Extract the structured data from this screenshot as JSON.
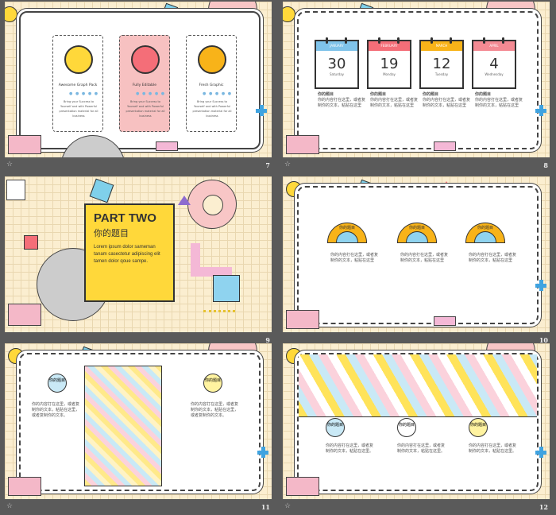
{
  "slides": [
    {
      "number": "7",
      "packages": [
        {
          "title": "Awesome Graph Pack",
          "dots": "● ● ● ● ●",
          "desc": "Bring your Success to Yourself and with Powerful presentation material for all business"
        },
        {
          "title": "Fully Editable",
          "dots": "● ● ● ● ●",
          "desc": "Bring your Success to Yourself and with Powerful presentation material for all business"
        },
        {
          "title": "Fresh Graphic",
          "dots": "● ● ● ● ●",
          "desc": "Bring your Success to Yourself and with Powerful presentation material for all business"
        }
      ]
    },
    {
      "number": "8",
      "calendars": [
        {
          "month": "JANUARY",
          "day": "30",
          "weekday": "Saturday",
          "color": "#7fc3ea"
        },
        {
          "month": "FEBRUARY",
          "day": "19",
          "weekday": "Monday",
          "color": "#f46e78"
        },
        {
          "month": "MARCH",
          "day": "12",
          "weekday": "Tuesday",
          "color": "#f8b319"
        },
        {
          "month": "APRIL",
          "day": "4",
          "weekday": "Wednesday",
          "color": "#f48a93"
        }
      ],
      "col_title": "你的题目",
      "col_text": "你的内容打在这里，或者复制你的文本，粘贴在这里"
    },
    {
      "number": "9",
      "title": "PART TWO",
      "subtitle": "你的题目",
      "body": "Lorem ipsum dolor sameman tanam casectetur adipiscing elit tamen dolor qoue sampe."
    },
    {
      "number": "10",
      "semi_label": "你的题目",
      "col_text": "你的内容打在这里，或者复制你的文本，粘贴在这里"
    },
    {
      "number": "11",
      "badge": "你的题目",
      "col_text": "你的内容打在这里，或者复制你的文本，粘贴在这里，或者复制你的文本。"
    },
    {
      "number": "12",
      "badge": "你的题目",
      "col_text": "你的内容打在这里，或者复制你的文本，粘贴在这里。"
    }
  ],
  "star_icon": "☆"
}
